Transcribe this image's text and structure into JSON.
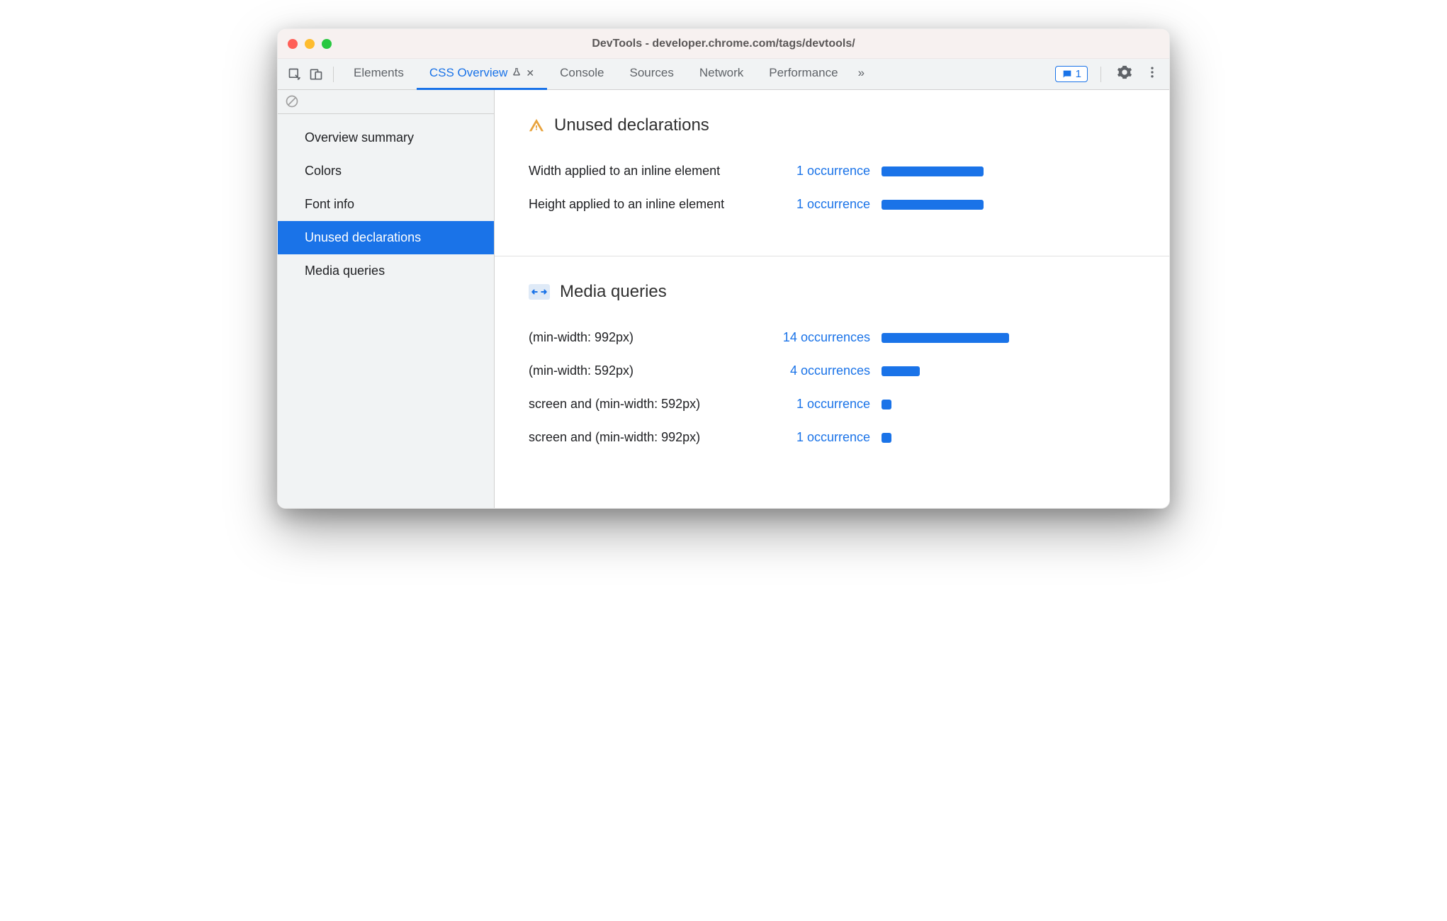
{
  "window": {
    "title": "DevTools - developer.chrome.com/tags/devtools/"
  },
  "toolbar": {
    "tabs": [
      {
        "label": "Elements",
        "active": false
      },
      {
        "label": "CSS Overview",
        "active": true,
        "experimental": true,
        "closable": true
      },
      {
        "label": "Console",
        "active": false
      },
      {
        "label": "Sources",
        "active": false
      },
      {
        "label": "Network",
        "active": false
      },
      {
        "label": "Performance",
        "active": false
      }
    ],
    "more_tabs_icon": "»",
    "messages_count": "1"
  },
  "sidebar": {
    "items": [
      {
        "label": "Overview summary",
        "selected": false
      },
      {
        "label": "Colors",
        "selected": false
      },
      {
        "label": "Font info",
        "selected": false
      },
      {
        "label": "Unused declarations",
        "selected": true
      },
      {
        "label": "Media queries",
        "selected": false
      }
    ]
  },
  "sections": {
    "unused": {
      "title": "Unused declarations",
      "rows": [
        {
          "label": "Width applied to an inline element",
          "link": "1 occurrence",
          "bar_pct": 80
        },
        {
          "label": "Height applied to an inline element",
          "link": "1 occurrence",
          "bar_pct": 80
        }
      ]
    },
    "media": {
      "title": "Media queries",
      "rows": [
        {
          "label": "(min-width: 992px)",
          "link": "14 occurrences",
          "bar_pct": 100
        },
        {
          "label": "(min-width: 592px)",
          "link": "4 occurrences",
          "bar_pct": 30
        },
        {
          "label": "screen and (min-width: 592px)",
          "link": "1 occurrence",
          "bar_pct": 8
        },
        {
          "label": "screen and (min-width: 992px)",
          "link": "1 occurrence",
          "bar_pct": 8
        }
      ]
    }
  }
}
